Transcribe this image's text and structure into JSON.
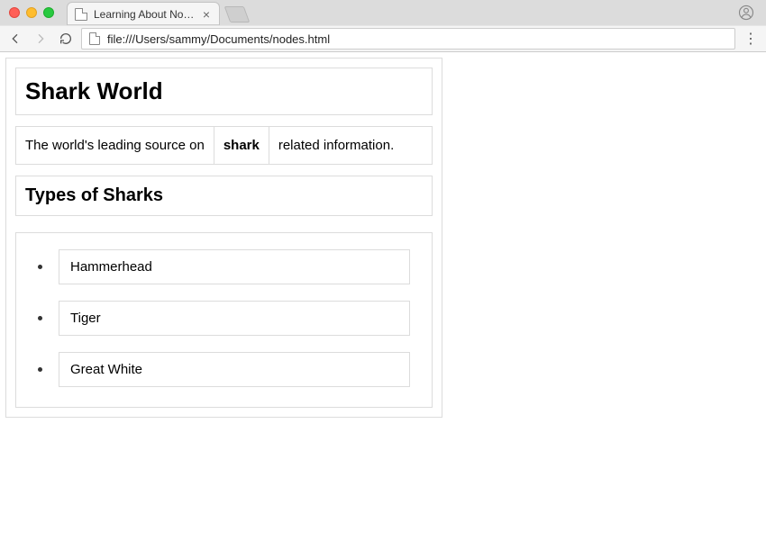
{
  "browser": {
    "tab_title": "Learning About Nodes",
    "url": "file:///Users/sammy/Documents/nodes.html"
  },
  "page": {
    "h1": "Shark World",
    "p_pre": "The world's leading source on ",
    "p_strong": "shark",
    "p_post": " related information.",
    "h2": "Types of Sharks",
    "listItems": [
      "Hammerhead",
      "Tiger",
      "Great White"
    ]
  }
}
